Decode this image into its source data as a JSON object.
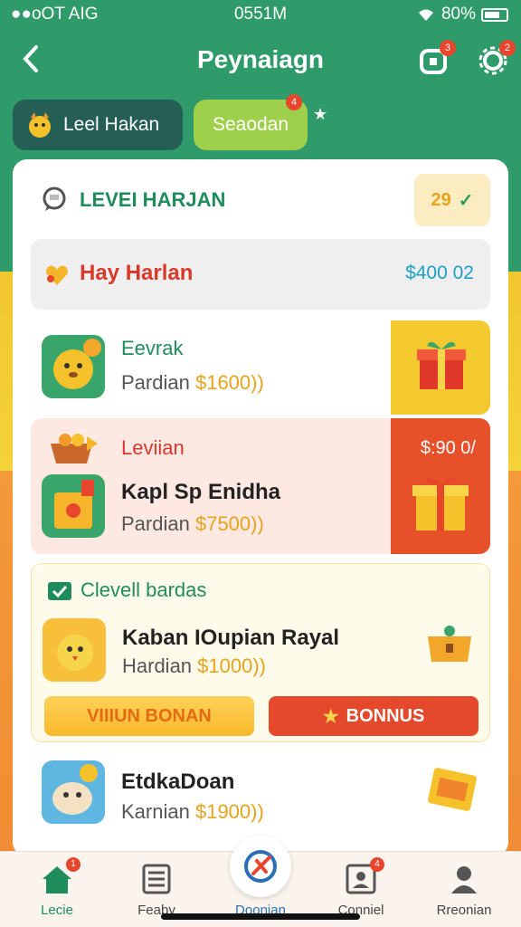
{
  "status_bar": {
    "carrier": "●●oOT AIG",
    "time": "0551M",
    "battery": "80%"
  },
  "header": {
    "title": "Peynaiagn",
    "back_icon": "chevron-left-icon",
    "gift_badge": "3",
    "settings_badge": "2"
  },
  "tabs": [
    {
      "label": "Leel Hakan",
      "active": false
    },
    {
      "label": "Seaodan",
      "active": true,
      "badge": "4"
    }
  ],
  "card": {
    "level_title": "LEVEI HARJAN",
    "check_value": "29",
    "hay_row": {
      "label": "Hay Harlan",
      "amount": "$400 02"
    },
    "rows": [
      {
        "kicker": "Eevrak",
        "sub_label": "Pardian",
        "amount": "$1600))"
      },
      {
        "kicker": "Leviian",
        "title": "Kapl Sp Enidha",
        "sub_label": "Pardian",
        "amount": "$7500))",
        "side_price": "$:90 0/"
      },
      {
        "kicker": "Clevell bardas",
        "title": "Kaban IOupian Rayal",
        "sub_label": "Hardian",
        "amount": "$1000))",
        "btn_vip": "VIIIUN BONAN",
        "btn_bonus": "BONNUS"
      },
      {
        "title": "EtdkaDoan",
        "sub_label": "Karnian",
        "amount": "$1900))"
      }
    ]
  },
  "bottom_nav": [
    {
      "label": "Lecie",
      "icon": "home-icon",
      "badge": "1",
      "active": true
    },
    {
      "label": "Feaby",
      "icon": "list-icon"
    },
    {
      "label": "Doonian",
      "icon": "compass-icon",
      "center": true
    },
    {
      "label": "Conniel",
      "icon": "contact-card-icon",
      "badge": "4"
    },
    {
      "label": "Rreonian",
      "icon": "person-icon"
    }
  ],
  "colors": {
    "header_green": "#2f9a6a",
    "accent_red": "#e6512a",
    "accent_yellow": "#f4c82f",
    "gold_text": "#e7a21e"
  }
}
